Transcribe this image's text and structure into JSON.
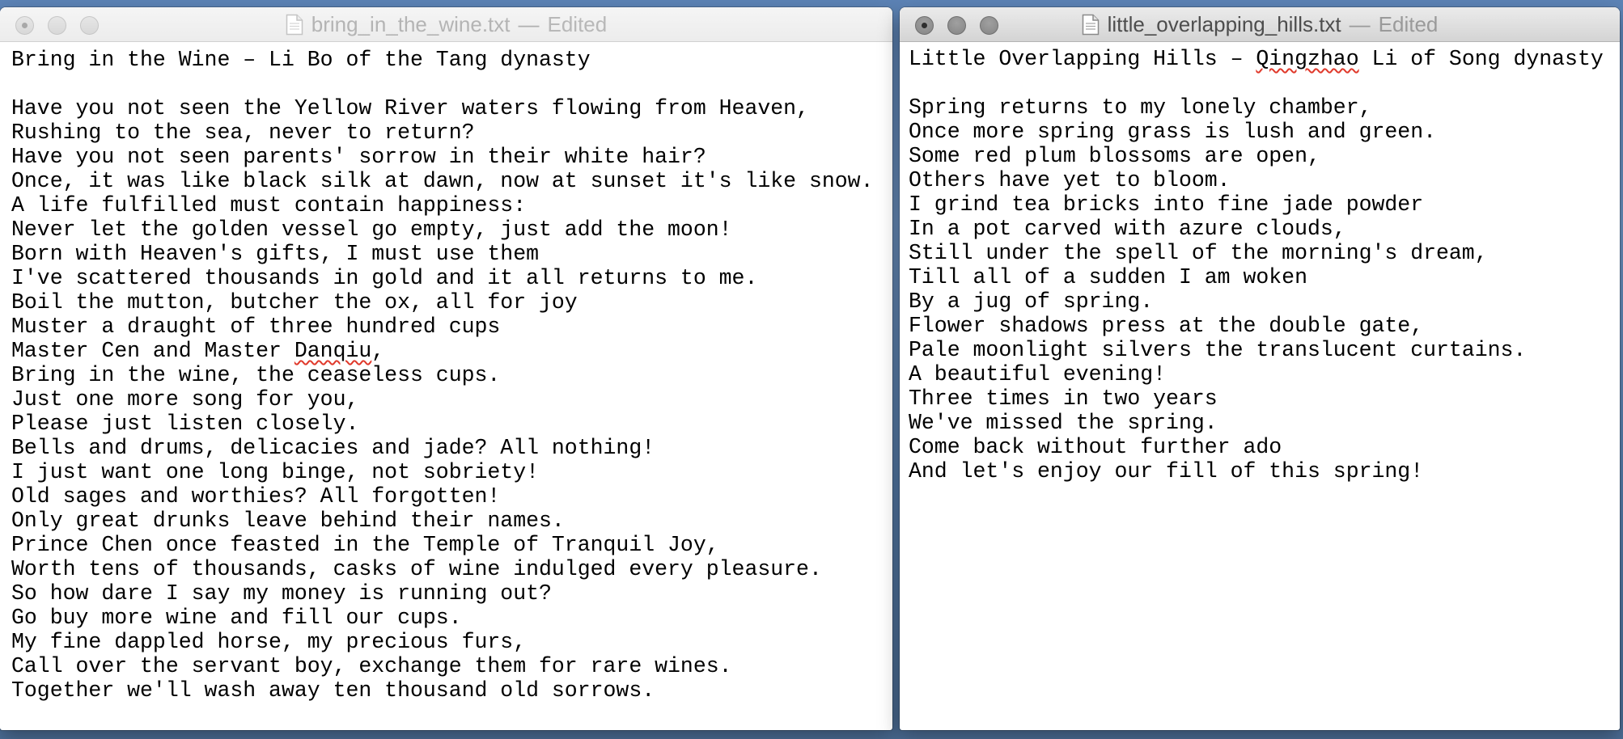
{
  "left_window": {
    "filename": "bring_in_the_wine.txt",
    "separator": "—",
    "status": "Edited",
    "lines": [
      "Bring in the Wine – Li Bo of the Tang dynasty",
      "",
      "Have you not seen the Yellow River waters flowing from Heaven,",
      "Rushing to the sea, never to return?",
      "Have you not seen parents' sorrow in their white hair?",
      "Once, it was like black silk at dawn, now at sunset it's like snow.",
      "A life fulfilled must contain happiness:",
      "Never let the golden vessel go empty, just add the moon!",
      "Born with Heaven's gifts, I must use them",
      "I've scattered thousands in gold and it all returns to me.",
      "Boil the mutton, butcher the ox, all for joy",
      "Muster a draught of three hundred cups",
      "Master Cen and Master Danqiu,",
      "Bring in the wine, the ceaseless cups.",
      "Just one more song for you,",
      "Please just listen closely.",
      "Bells and drums, delicacies and jade? All nothing!",
      "I just want one long binge, not sobriety!",
      "Old sages and worthies? All forgotten!",
      "Only great drunks leave behind their names.",
      "Prince Chen once feasted in the Temple of Tranquil Joy,",
      "Worth tens of thousands, casks of wine indulged every pleasure.",
      "So how dare I say my money is running out?",
      "Go buy more wine and fill our cups.",
      "My fine dappled horse, my precious furs,",
      "Call over the servant boy, exchange them for rare wines.",
      "Together we'll wash away ten thousand old sorrows."
    ],
    "misspelled_word": "Danqiu"
  },
  "right_window": {
    "filename": "little_overlapping_hills.txt",
    "separator": "—",
    "status": "Edited",
    "lines": [
      "Little Overlapping Hills – Qingzhao Li of Song dynasty",
      "",
      "Spring returns to my lonely chamber,",
      "Once more spring grass is lush and green.",
      "Some red plum blossoms are open,",
      "Others have yet to bloom.",
      "I grind tea bricks into fine jade powder",
      "In a pot carved with azure clouds,",
      "Still under the spell of the morning's dream,",
      "Till all of a sudden I am woken",
      "By a jug of spring.",
      "Flower shadows press at the double gate,",
      "Pale moonlight silvers the translucent curtains.",
      "A beautiful evening!",
      "Three times in two years",
      "We've missed the spring.",
      "Come back without further ado",
      "And let's enjoy our fill of this spring!"
    ],
    "misspelled_word": "Qingzhao",
    "caret_line": 1
  }
}
